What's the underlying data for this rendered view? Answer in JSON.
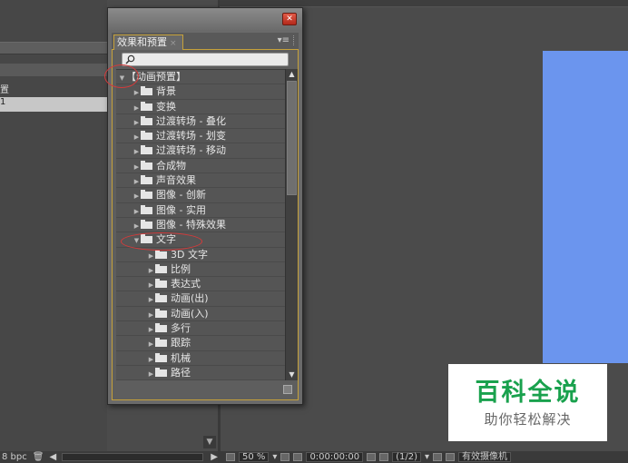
{
  "background": {
    "left_row1": "置",
    "left_row2": "1"
  },
  "panel": {
    "tab_label": "效果和预置",
    "tab_close": "×",
    "menu_glyph": "▾≡",
    "close_glyph": "✕",
    "search_value": "",
    "tree": [
      {
        "label": "【动画预置】",
        "level": 0,
        "expanded": true,
        "folder": false
      },
      {
        "label": "背景",
        "level": 1,
        "expanded": false,
        "folder": true
      },
      {
        "label": "变换",
        "level": 1,
        "expanded": false,
        "folder": true
      },
      {
        "label": "过渡转场 - 叠化",
        "level": 1,
        "expanded": false,
        "folder": true
      },
      {
        "label": "过渡转场 - 划变",
        "level": 1,
        "expanded": false,
        "folder": true
      },
      {
        "label": "过渡转场 - 移动",
        "level": 1,
        "expanded": false,
        "folder": true
      },
      {
        "label": "合成物",
        "level": 1,
        "expanded": false,
        "folder": true
      },
      {
        "label": "声音效果",
        "level": 1,
        "expanded": false,
        "folder": true
      },
      {
        "label": "图像 - 创新",
        "level": 1,
        "expanded": false,
        "folder": true
      },
      {
        "label": "图像 - 实用",
        "level": 1,
        "expanded": false,
        "folder": true
      },
      {
        "label": "图像 - 特殊效果",
        "level": 1,
        "expanded": false,
        "folder": true
      },
      {
        "label": "文字",
        "level": 1,
        "expanded": true,
        "folder": true
      },
      {
        "label": "3D 文字",
        "level": 2,
        "expanded": false,
        "folder": true
      },
      {
        "label": "比例",
        "level": 2,
        "expanded": false,
        "folder": true
      },
      {
        "label": "表达式",
        "level": 2,
        "expanded": false,
        "folder": true
      },
      {
        "label": "动画(出)",
        "level": 2,
        "expanded": false,
        "folder": true
      },
      {
        "label": "动画(入)",
        "level": 2,
        "expanded": false,
        "folder": true
      },
      {
        "label": "多行",
        "level": 2,
        "expanded": false,
        "folder": true
      },
      {
        "label": "跟踪",
        "level": 2,
        "expanded": false,
        "folder": true
      },
      {
        "label": "机械",
        "level": 2,
        "expanded": false,
        "folder": true
      },
      {
        "label": "路径",
        "level": 2,
        "expanded": false,
        "folder": true
      }
    ]
  },
  "status_bar": {
    "left_text": "8 bpc",
    "zoom": "50 %",
    "timecode": "0:00:00:00",
    "resolution": "(1/2)",
    "camera": "有效摄像机"
  },
  "watermark": {
    "title": "百科全说",
    "subtitle": "助你轻松解决"
  },
  "colors": {
    "accent_border": "#c6a13a",
    "annotation": "#d63a3a",
    "preview_blue": "#6b95ee",
    "watermark_green": "#19a14d"
  }
}
